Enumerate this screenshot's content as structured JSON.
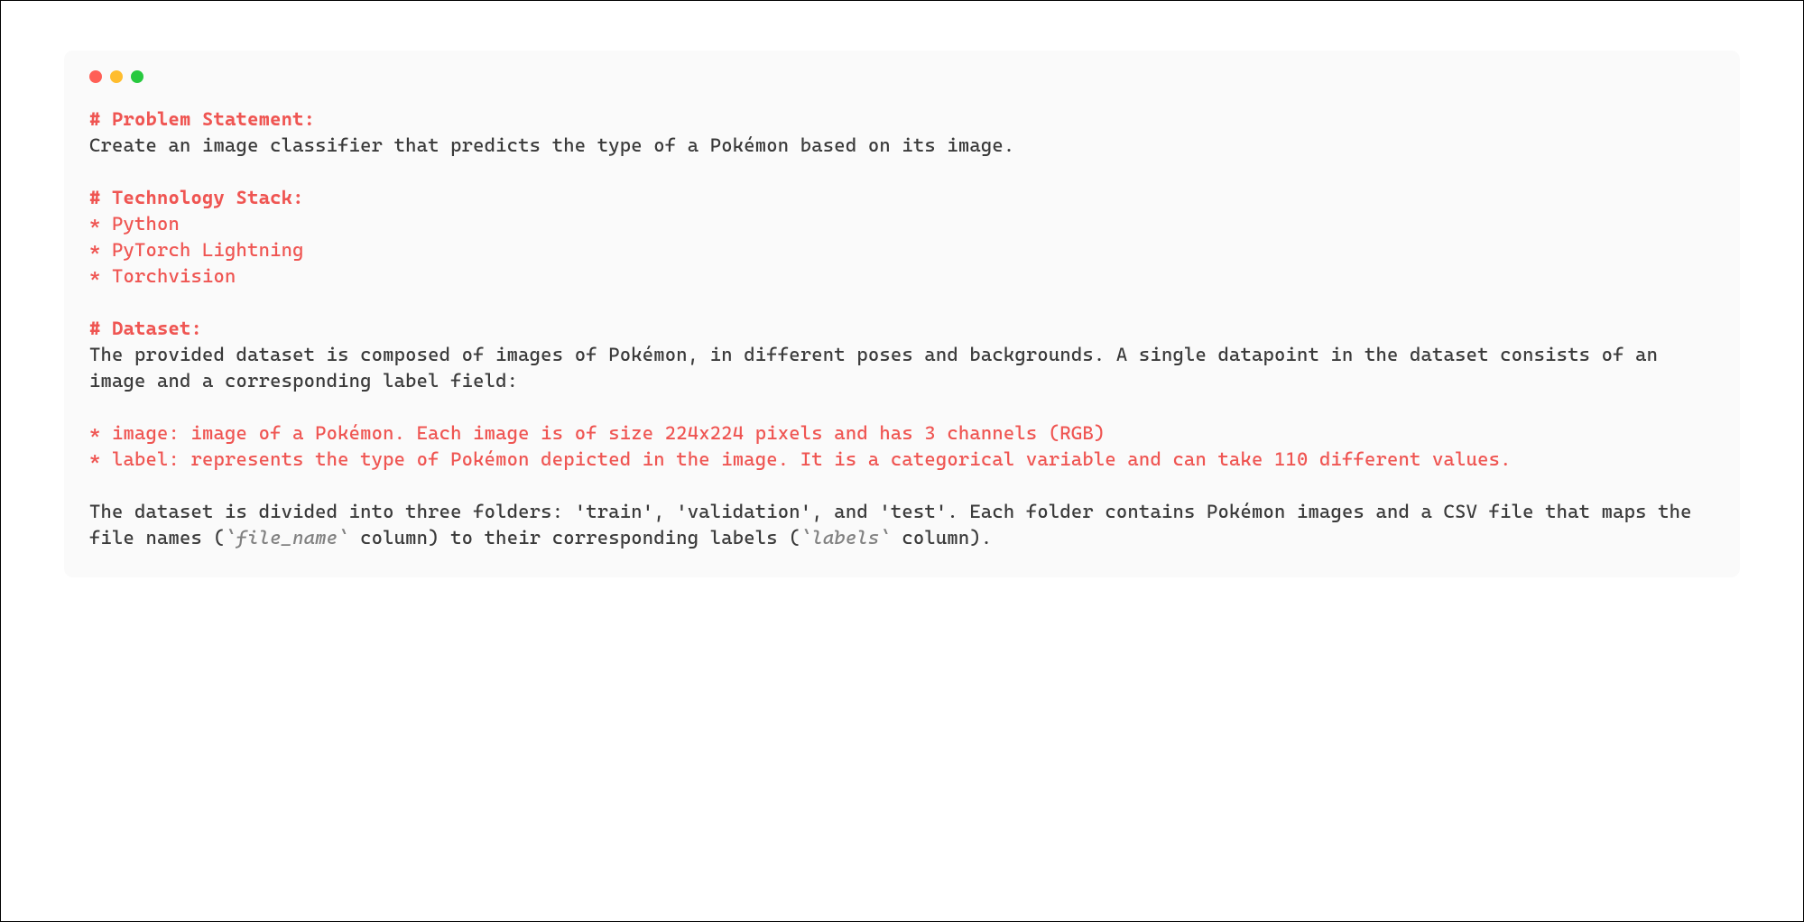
{
  "headings": {
    "problem": "# Problem Statement:",
    "stack": "# Technology Stack:",
    "dataset": "# Dataset:"
  },
  "problem_body": "Create an image classifier that predicts the type of a Pokémon based on its image.",
  "stack_items": {
    "i1": "* Python",
    "i2": "* PyTorch Lightning",
    "i3": "* Torchvision"
  },
  "dataset_intro": "The provided dataset is composed of images of Pokémon, in different poses and backgrounds. A single datapoint in the dataset consists of an image and a corresponding label field:",
  "dataset_fields": {
    "image": "* image: image of a Pokémon. Each image is of size 224x224 pixels and has 3 channels (RGB)",
    "label": "* label: represents the type of Pokémon depicted in the image. It is a categorical variable and can take 110 different values."
  },
  "folders_sentence": {
    "p1": "The dataset is divided into three folders: 'train', 'validation', and 'test'. Each folder contains Pokémon images and a CSV file that maps the file names (",
    "code1": "`file_name`",
    "p2": " column) to their corresponding labels (",
    "code2": "`labels`",
    "p3": " column)."
  }
}
